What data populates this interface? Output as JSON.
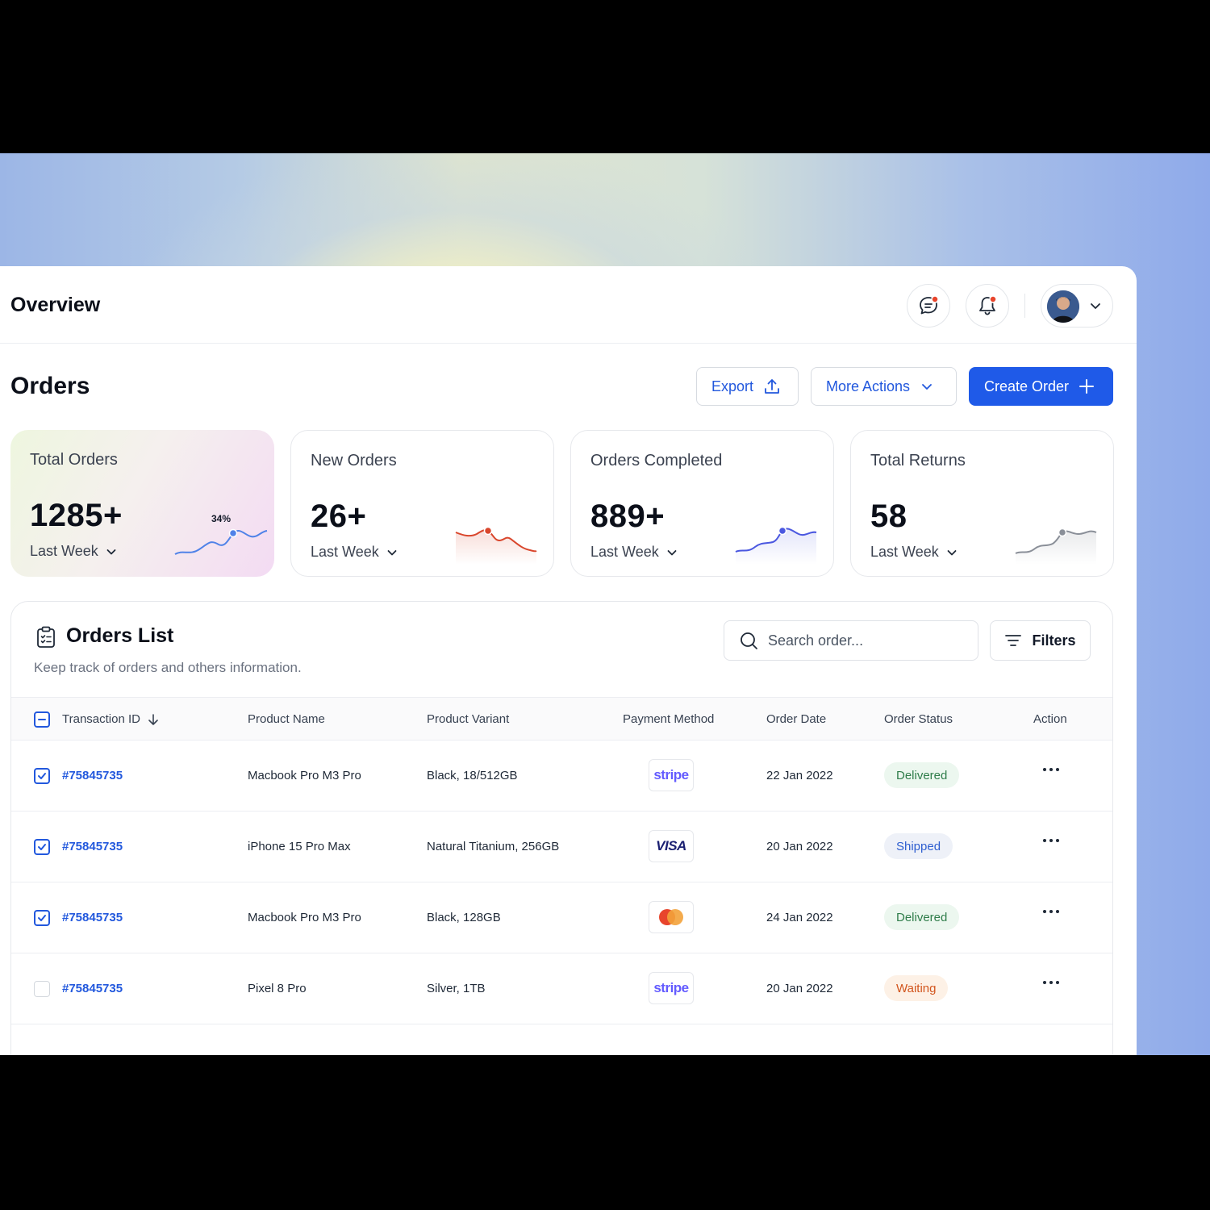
{
  "topbar": {
    "title": "Overview"
  },
  "page": {
    "title": "Orders"
  },
  "actions": {
    "export": "Export",
    "more": "More Actions",
    "create": "Create Order"
  },
  "stats": [
    {
      "label": "Total Orders",
      "value": "1285+",
      "period": "Last Week",
      "badge": "34%",
      "color": "#4f82e8"
    },
    {
      "label": "New Orders",
      "value": "26+",
      "period": "Last Week",
      "color": "#d9462c"
    },
    {
      "label": "Orders Completed",
      "value": "889+",
      "period": "Last Week",
      "color": "#4a57e0"
    },
    {
      "label": "Total Returns",
      "value": "58",
      "period": "Last Week",
      "color": "#8a8f98"
    }
  ],
  "orders_list": {
    "title": "Orders List",
    "subtitle": "Keep track of orders and others information.",
    "search_placeholder": "Search order...",
    "filters": "Filters",
    "columns": [
      "Transaction ID",
      "Product Name",
      "Product Variant",
      "Payment Method",
      "Order Date",
      "Order Status",
      "Action"
    ],
    "rows": [
      {
        "id": "#75845735",
        "product": "Macbook Pro M3 Pro",
        "variant": "Black, 18/512GB",
        "payment": "stripe",
        "date": "22 Jan 2022",
        "status": "Delivered",
        "checked": true
      },
      {
        "id": "#75845735",
        "product": "iPhone 15 Pro Max",
        "variant": "Natural Titanium, 256GB",
        "payment": "VISA",
        "date": "20 Jan 2022",
        "status": "Shipped",
        "checked": true
      },
      {
        "id": "#75845735",
        "product": "Macbook Pro M3 Pro",
        "variant": "Black, 128GB",
        "payment": "mastercard",
        "date": "24 Jan 2022",
        "status": "Delivered",
        "checked": true
      },
      {
        "id": "#75845735",
        "product": "Pixel 8 Pro",
        "variant": "Silver, 1TB",
        "payment": "stripe",
        "date": "20 Jan 2022",
        "status": "Waiting",
        "checked": false
      }
    ]
  }
}
